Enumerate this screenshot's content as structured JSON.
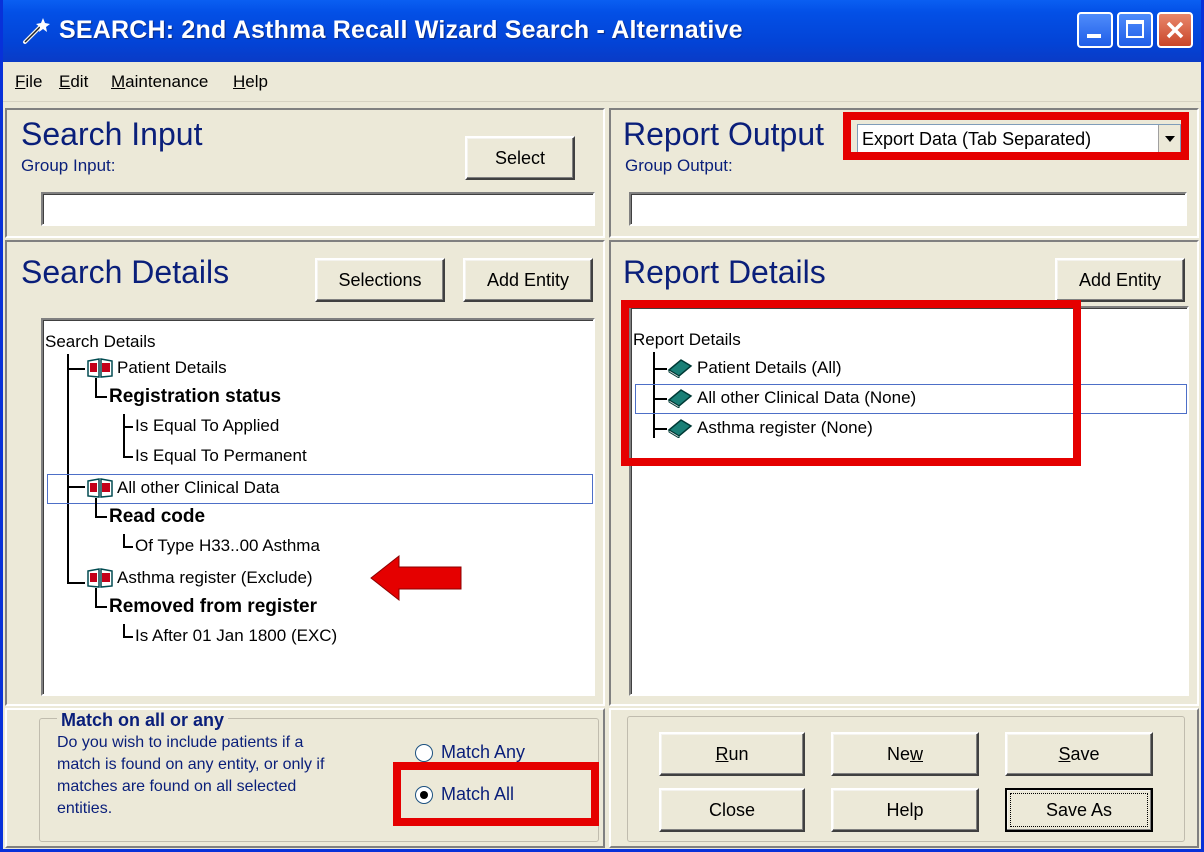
{
  "window": {
    "title": "SEARCH: 2nd Asthma Recall Wizard Search - Alternative"
  },
  "menu": [
    {
      "label": "File",
      "mnemonic": "F"
    },
    {
      "label": "Edit",
      "mnemonic": "E"
    },
    {
      "label": "Maintenance",
      "mnemonic": "M"
    },
    {
      "label": "Help",
      "mnemonic": "H"
    }
  ],
  "search_input": {
    "title": "Search Input",
    "group_label": "Group Input:",
    "select_button": "Select",
    "group_value": ""
  },
  "report_output": {
    "title": "Report Output",
    "format_selected": "Export Data (Tab Separated)",
    "group_label": "Group Output:",
    "group_value": ""
  },
  "search_details": {
    "title": "Search Details",
    "selections_button": "Selections",
    "add_entity_button": "Add Entity",
    "tree": {
      "root": "Search Details",
      "entities": [
        {
          "label": "Patient Details",
          "criterion": "Registration status",
          "values": [
            "Is Equal To Applied",
            "Is Equal To Permanent"
          ]
        },
        {
          "label": "All other Clinical Data",
          "criterion": "Read code",
          "values": [
            "Of Type H33..00 Asthma"
          ]
        },
        {
          "label": "Asthma register (Exclude)",
          "criterion": "Removed from register",
          "values": [
            "Is After 01 Jan 1800 (EXC)"
          ]
        }
      ]
    }
  },
  "report_details": {
    "title": "Report Details",
    "add_entity_button": "Add Entity",
    "tree": {
      "root": "Report Details",
      "entities": [
        "Patient Details (All)",
        "All other Clinical Data (None)",
        "Asthma register (None)"
      ]
    }
  },
  "match": {
    "title": "Match on all or any",
    "description_1": "Do you wish to include patients if a",
    "description_2": "match is found on any entity, or only if",
    "description_3": "matches are found on all selected",
    "description_4": "entities.",
    "option_any": "Match Any",
    "option_all": "Match All",
    "selected": "Match All"
  },
  "actions": {
    "run": "Run",
    "new": "New",
    "save": "Save",
    "close": "Close",
    "help": "Help",
    "save_as": "Save As"
  },
  "colors": {
    "title_bar": "#0350e6",
    "highlight_red": "#e50000",
    "section_title": "#0a1f7a"
  }
}
